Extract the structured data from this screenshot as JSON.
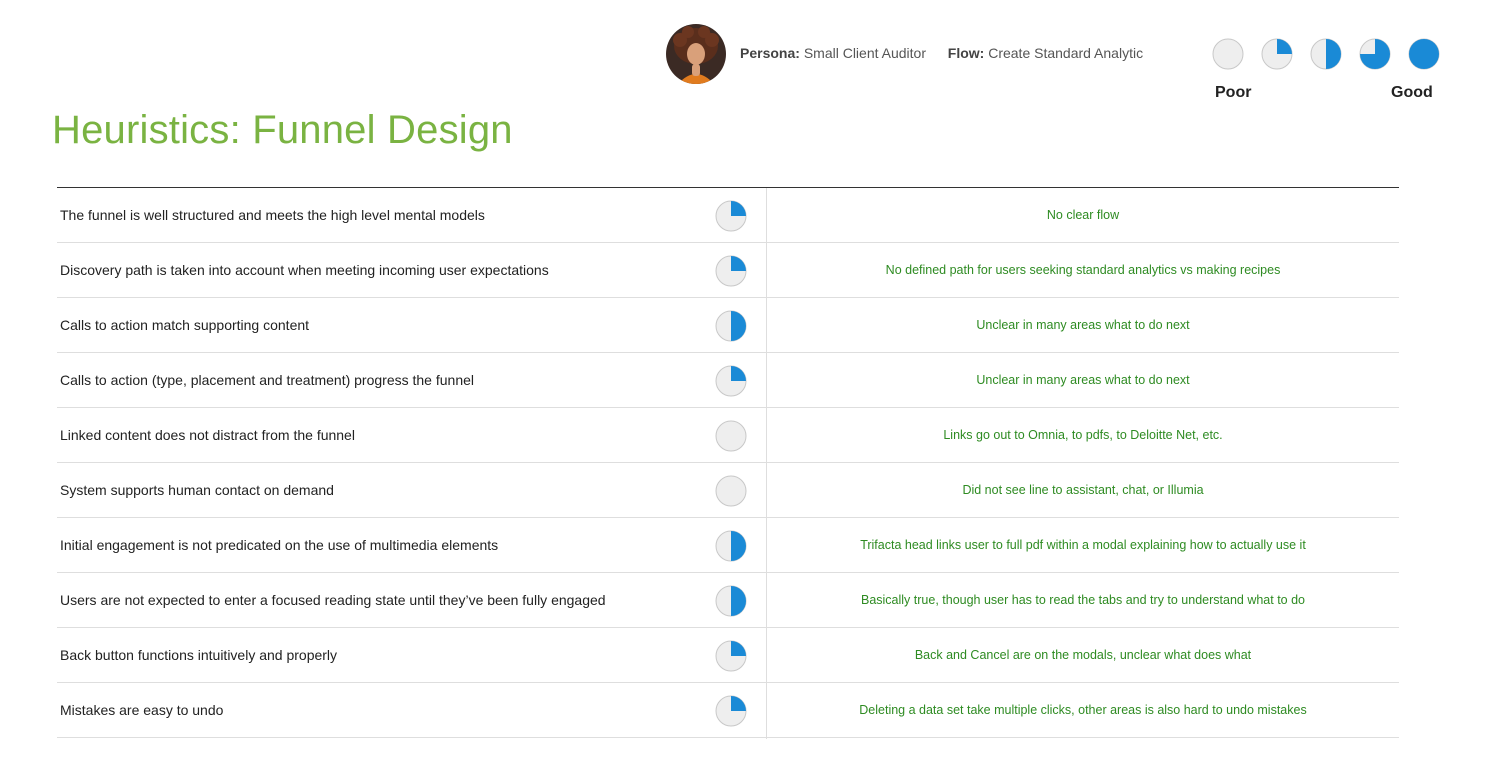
{
  "header": {
    "persona_label": "Persona:",
    "persona_value": "Small Client Auditor",
    "flow_label": "Flow:",
    "flow_value": "Create Standard Analytic"
  },
  "legend": {
    "levels": [
      0,
      0.25,
      0.5,
      0.75,
      1
    ],
    "poor_label": "Poor",
    "good_label": "Good"
  },
  "title": "Heuristics: Funnel Design",
  "colors": {
    "accent": "#7ab342",
    "rating_fill": "#1a8ad6",
    "rating_empty": "#eeeeee",
    "note_text": "#2e8b22"
  },
  "rows": [
    {
      "label": "The funnel is well structured and meets the high level mental models",
      "rating": 0.25,
      "note": "No clear flow"
    },
    {
      "label": "Discovery path is taken into account when meeting incoming user expectations",
      "rating": 0.25,
      "note": "No defined path for users seeking standard analytics vs making recipes"
    },
    {
      "label": "Calls to action match supporting content",
      "rating": 0.5,
      "note": "Unclear in many areas what to do next"
    },
    {
      "label": "Calls to action (type, placement and treatment) progress the funnel",
      "rating": 0.25,
      "note": "Unclear in many areas what to do next"
    },
    {
      "label": "Linked content does not distract from the funnel",
      "rating": 0,
      "note": "Links go out to Omnia, to pdfs, to Deloitte Net, etc."
    },
    {
      "label": "System supports human contact on demand",
      "rating": 0,
      "note": "Did not see line to assistant, chat, or Illumia"
    },
    {
      "label": "Initial engagement is not predicated on the use of multimedia elements",
      "rating": 0.5,
      "note": "Trifacta head links user to full pdf within a modal explaining how to actually use it"
    },
    {
      "label": "Users are not expected to enter a focused reading state until they’ve been fully engaged",
      "rating": 0.5,
      "note": "Basically true, though user has to read the tabs and try to understand what to do"
    },
    {
      "label": "Back button functions intuitively and properly",
      "rating": 0.25,
      "note": "Back and Cancel are on the modals, unclear what does what"
    },
    {
      "label": "Mistakes are easy to undo",
      "rating": 0.25,
      "note": "Deleting a data set take multiple clicks, other areas is also hard to undo mistakes"
    }
  ]
}
